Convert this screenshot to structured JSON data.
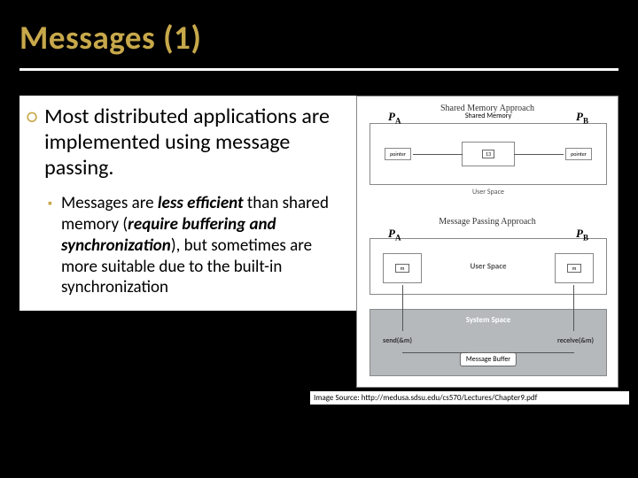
{
  "title": "Messages (1)",
  "bullets": {
    "main": "Most distributed applications are implemented using message passing.",
    "sub_pre": "Messages are ",
    "sub_em1": "less efficient",
    "sub_mid1": " than shared memory (",
    "sub_em2": "require buffering and synchronization",
    "sub_mid2": "), but sometimes are more suitable due to the built-in synchronization"
  },
  "diagram": {
    "shm_title": "Shared Memory Approach",
    "mp_title": "Message Passing Approach",
    "pA": "P",
    "pA_sub": "A",
    "pB": "P",
    "pB_sub": "B",
    "shared_memory": "Shared Memory",
    "pointer": "pointer",
    "user_space": "User Space",
    "system_space": "System Space",
    "send": "send(&m)",
    "receive": "receive(&m)",
    "msg_buffer": "Message Buffer",
    "m": "m",
    "x": "13"
  },
  "image_source": "Image Source: http://medusa.sdsu.edu/cs570/Lectures/Chapter9.pdf"
}
